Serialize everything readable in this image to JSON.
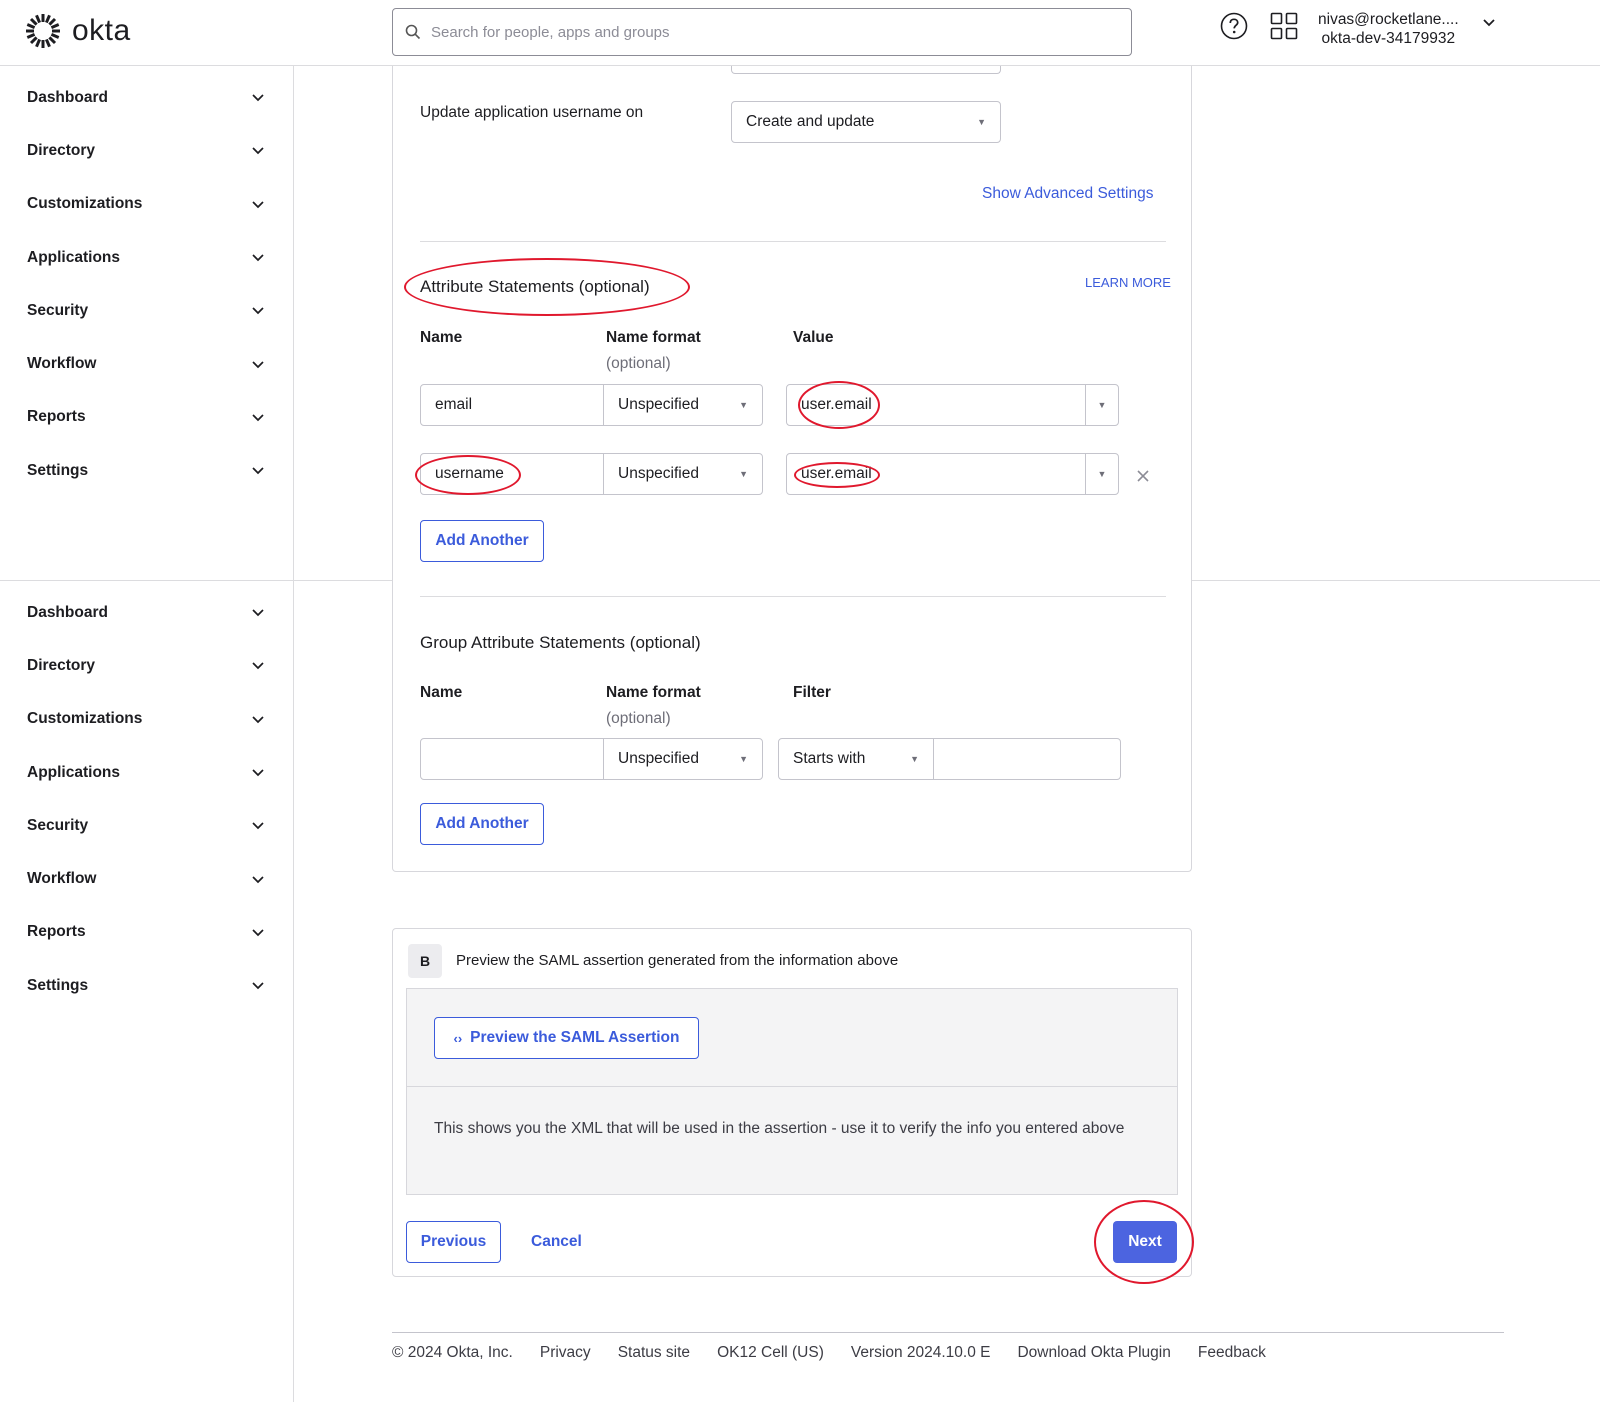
{
  "header": {
    "logo_text": "okta",
    "search_placeholder": "Search for people, apps and groups",
    "user_email": "nivas@rocketlane....",
    "user_org": "okta-dev-34179932"
  },
  "sidebar": {
    "items": [
      "Dashboard",
      "Directory",
      "Customizations",
      "Applications",
      "Security",
      "Workflow",
      "Reports",
      "Settings"
    ]
  },
  "general": {
    "update_username_label": "Update application username on",
    "update_username_value": "Create and update",
    "show_advanced": "Show Advanced Settings"
  },
  "attributes": {
    "title": "Attribute Statements (optional)",
    "learn_more": "LEARN MORE",
    "col_name": "Name",
    "col_format": "Name format",
    "col_format_sub": "(optional)",
    "col_value": "Value",
    "rows": [
      {
        "name": "email",
        "format": "Unspecified",
        "value": "user.email"
      },
      {
        "name": "username",
        "format": "Unspecified",
        "value": "user.email"
      }
    ],
    "add_another": "Add Another"
  },
  "group_attributes": {
    "title": "Group Attribute Statements (optional)",
    "col_name": "Name",
    "col_format": "Name format",
    "col_format_sub": "(optional)",
    "col_filter": "Filter",
    "row": {
      "name": "",
      "format": "Unspecified",
      "filter_type": "Starts with",
      "filter_value": ""
    },
    "add_another": "Add Another"
  },
  "section_b": {
    "badge": "B",
    "title": "Preview the SAML assertion generated from the information above",
    "preview_button": "Preview the SAML Assertion",
    "description": "This shows you the XML that will be used in the assertion - use it to verify the info you entered above"
  },
  "actions": {
    "previous": "Previous",
    "cancel": "Cancel",
    "next": "Next"
  },
  "footer": {
    "links": [
      "© 2024 Okta, Inc.",
      "Privacy",
      "Status site",
      "OK12 Cell (US)",
      "Version 2024.10.0 E",
      "Download Okta Plugin",
      "Feedback"
    ]
  },
  "colors": {
    "accent": "#4c64e0",
    "link": "#3b5bdb",
    "annotation": "#e0182d"
  }
}
